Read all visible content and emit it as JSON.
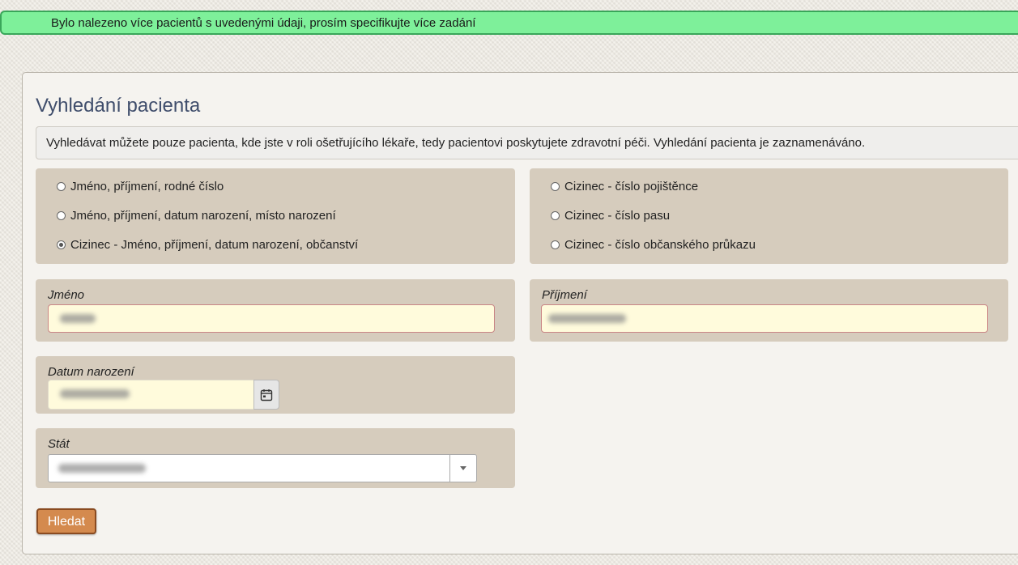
{
  "alert": {
    "text": "Bylo nalezeno více pacientů s uvedenými údaji, prosím specifikujte více zadání"
  },
  "page": {
    "title": "Vyhledání pacienta",
    "info": "Vyhledávat můžete pouze pacienta, kde jste v roli ošetřujícího lékaře, tedy pacientovi poskytujete zdravotní péči. Vyhledání pacienta je zaznamenáváno."
  },
  "search_options": {
    "left": [
      {
        "label": "Jméno, příjmení, rodné číslo",
        "checked": false
      },
      {
        "label": "Jméno, příjmení, datum narození, místo narození",
        "checked": false
      },
      {
        "label": "Cizinec - Jméno, příjmení, datum narození, občanství",
        "checked": true
      }
    ],
    "right": [
      {
        "label": "Cizinec - číslo pojištěnce",
        "checked": false
      },
      {
        "label": "Cizinec - číslo pasu",
        "checked": false
      },
      {
        "label": "Cizinec - číslo občanského průkazu",
        "checked": false
      }
    ]
  },
  "fields": {
    "first_name": {
      "label": "Jméno"
    },
    "last_name": {
      "label": "Příjmení"
    },
    "birth_date": {
      "label": "Datum narození",
      "icon": "calendar-icon"
    },
    "country": {
      "label": "Stát",
      "icon": "chevron-down-icon"
    }
  },
  "actions": {
    "search_label": "Hledat"
  },
  "colors": {
    "alert_bg": "#7ef09a",
    "box_bg": "#d6ccbd",
    "field_bg": "#fffbdc",
    "button_bg": "#d48a4e",
    "title": "#3f4d6b"
  }
}
